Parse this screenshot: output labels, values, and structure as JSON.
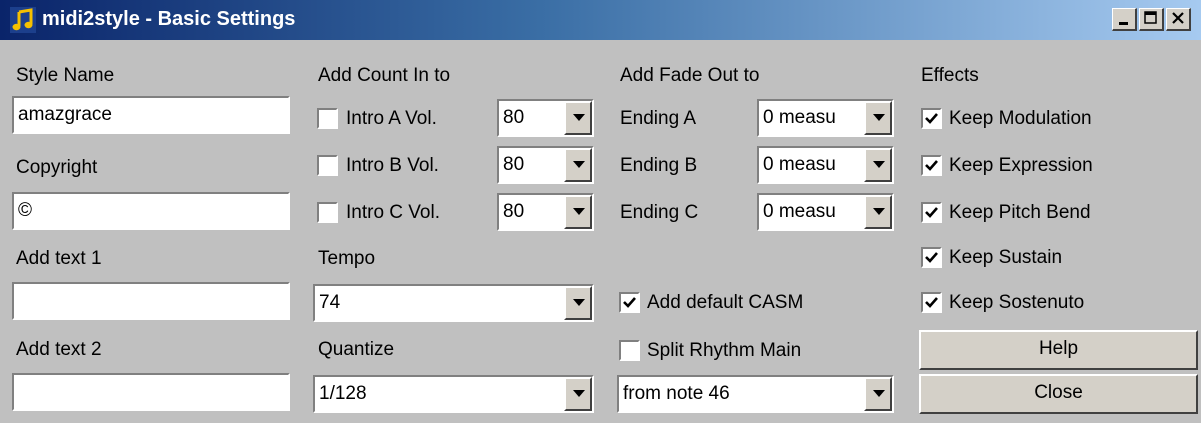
{
  "window": {
    "title": "midi2style - Basic Settings"
  },
  "labels": {
    "style_name": "Style Name",
    "copyright": "Copyright",
    "add_text_1": "Add text 1",
    "add_text_2": "Add text 2",
    "add_count_in_to": "Add Count In to",
    "tempo": "Tempo",
    "quantize": "Quantize",
    "add_fade_out_to": "Add Fade Out to",
    "effects": "Effects"
  },
  "fields": {
    "style_name": "amazgrace",
    "copyright": "©",
    "add_text_1": "",
    "add_text_2": ""
  },
  "count_in": [
    {
      "label": "Intro A Vol.",
      "checked": false,
      "volume": "80"
    },
    {
      "label": "Intro B Vol.",
      "checked": false,
      "volume": "80"
    },
    {
      "label": "Intro C Vol.",
      "checked": false,
      "volume": "80"
    }
  ],
  "tempo": "74",
  "quantize": "1/128",
  "fade_out": [
    {
      "label": "Ending A",
      "value": "0 measu"
    },
    {
      "label": "Ending B",
      "value": "0 measu"
    },
    {
      "label": "Ending C",
      "value": "0 measu"
    }
  ],
  "casm": {
    "label": "Add default CASM",
    "checked": true
  },
  "split_rhythm": {
    "label": "Split Rhythm Main",
    "checked": false,
    "value": "from note 46"
  },
  "effects": [
    {
      "label": "Keep Modulation",
      "checked": true
    },
    {
      "label": "Keep Expression",
      "checked": true
    },
    {
      "label": "Keep Pitch Bend",
      "checked": true
    },
    {
      "label": "Keep Sustain",
      "checked": true
    },
    {
      "label": "Keep Sostenuto",
      "checked": true
    }
  ],
  "buttons": {
    "help": "Help",
    "close": "Close"
  }
}
